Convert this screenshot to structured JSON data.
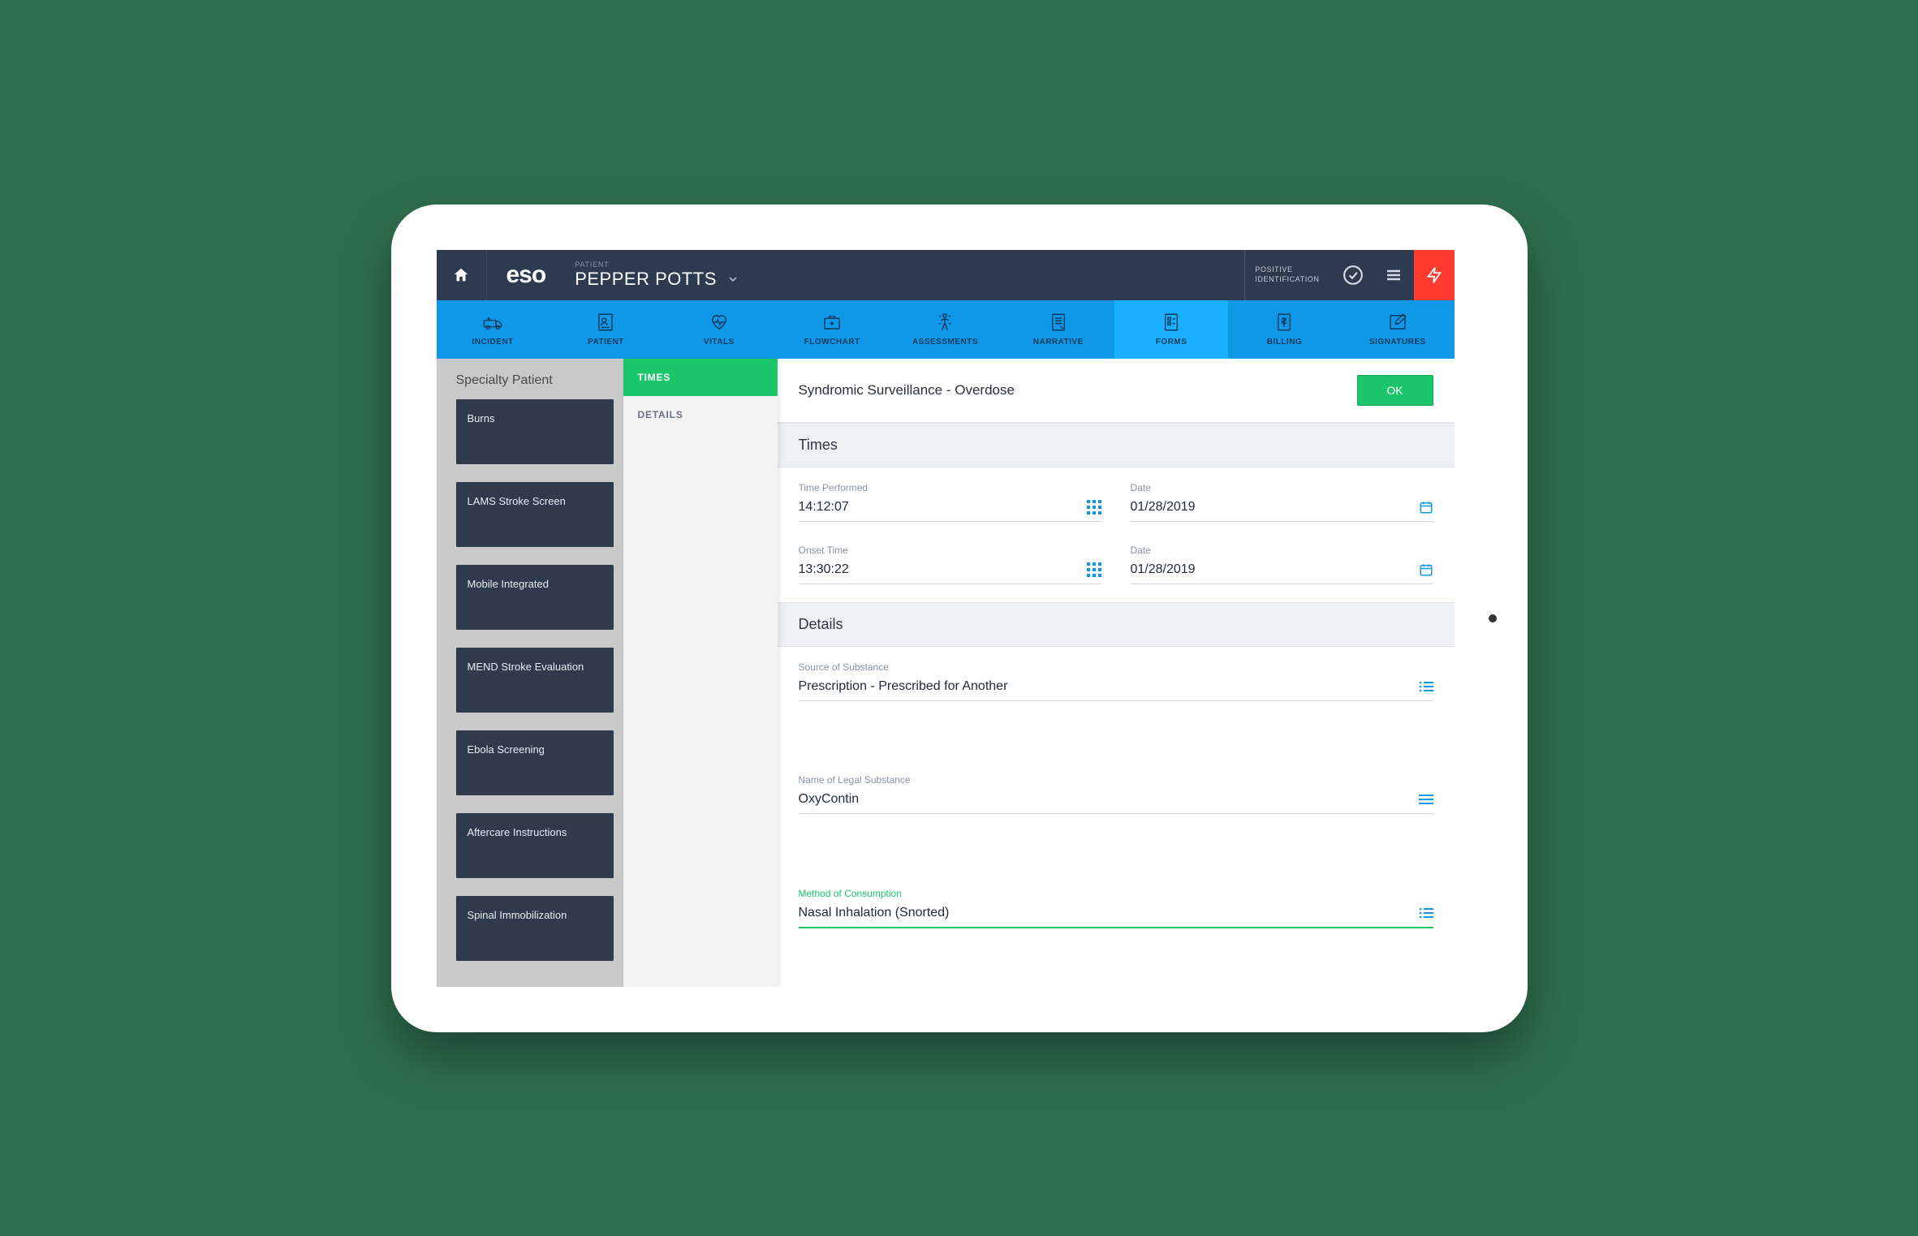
{
  "header": {
    "logo_text": "eso",
    "patient_label": "PATIENT",
    "patient_name": "PEPPER POTTS",
    "identification_line1": "POSITIVE",
    "identification_line2": "IDENTIFICATION"
  },
  "nav": {
    "items": [
      {
        "label": "INCIDENT"
      },
      {
        "label": "PATIENT"
      },
      {
        "label": "VITALS"
      },
      {
        "label": "FLOWCHART"
      },
      {
        "label": "ASSESSMENTS"
      },
      {
        "label": "NARRATIVE"
      },
      {
        "label": "FORMS"
      },
      {
        "label": "BILLING"
      },
      {
        "label": "SIGNATURES"
      }
    ],
    "active_index": 6
  },
  "specialty": {
    "title": "Specialty Patient",
    "cards": [
      {
        "label": "Burns"
      },
      {
        "label": "LAMS Stroke Screen"
      },
      {
        "label": "Mobile Integrated"
      },
      {
        "label": "MEND Stroke Evaluation"
      },
      {
        "label": "Ebola Screening"
      },
      {
        "label": "Aftercare Instructions"
      },
      {
        "label": "Spinal Immobilization"
      }
    ]
  },
  "subnav": {
    "items": [
      {
        "label": "TIMES"
      },
      {
        "label": "DETAILS"
      }
    ],
    "active_index": 0
  },
  "form": {
    "title": "Syndromic Surveillance - Overdose",
    "ok_label": "OK",
    "sections": {
      "times": {
        "heading": "Times",
        "time_performed_label": "Time Performed",
        "time_performed_value": "14:12:07",
        "time_performed_date_label": "Date",
        "time_performed_date_value": "01/28/2019",
        "onset_time_label": "Onset Time",
        "onset_time_value": "13:30:22",
        "onset_date_label": "Date",
        "onset_date_value": "01/28/2019"
      },
      "details": {
        "heading": "Details",
        "source_label": "Source of Substance",
        "source_value": "Prescription - Prescribed for Another",
        "name_label": "Name of Legal Substance",
        "name_value": "OxyContin",
        "method_label": "Method of Consumption",
        "method_value": "Nasal Inhalation (Snorted)"
      }
    }
  },
  "colors": {
    "brand_blue": "#0f98e8",
    "active_blue": "#19b0ff",
    "dark_header": "#2d3a4f",
    "accent_green": "#1bc66a",
    "alert_red": "#ff3b2f"
  }
}
